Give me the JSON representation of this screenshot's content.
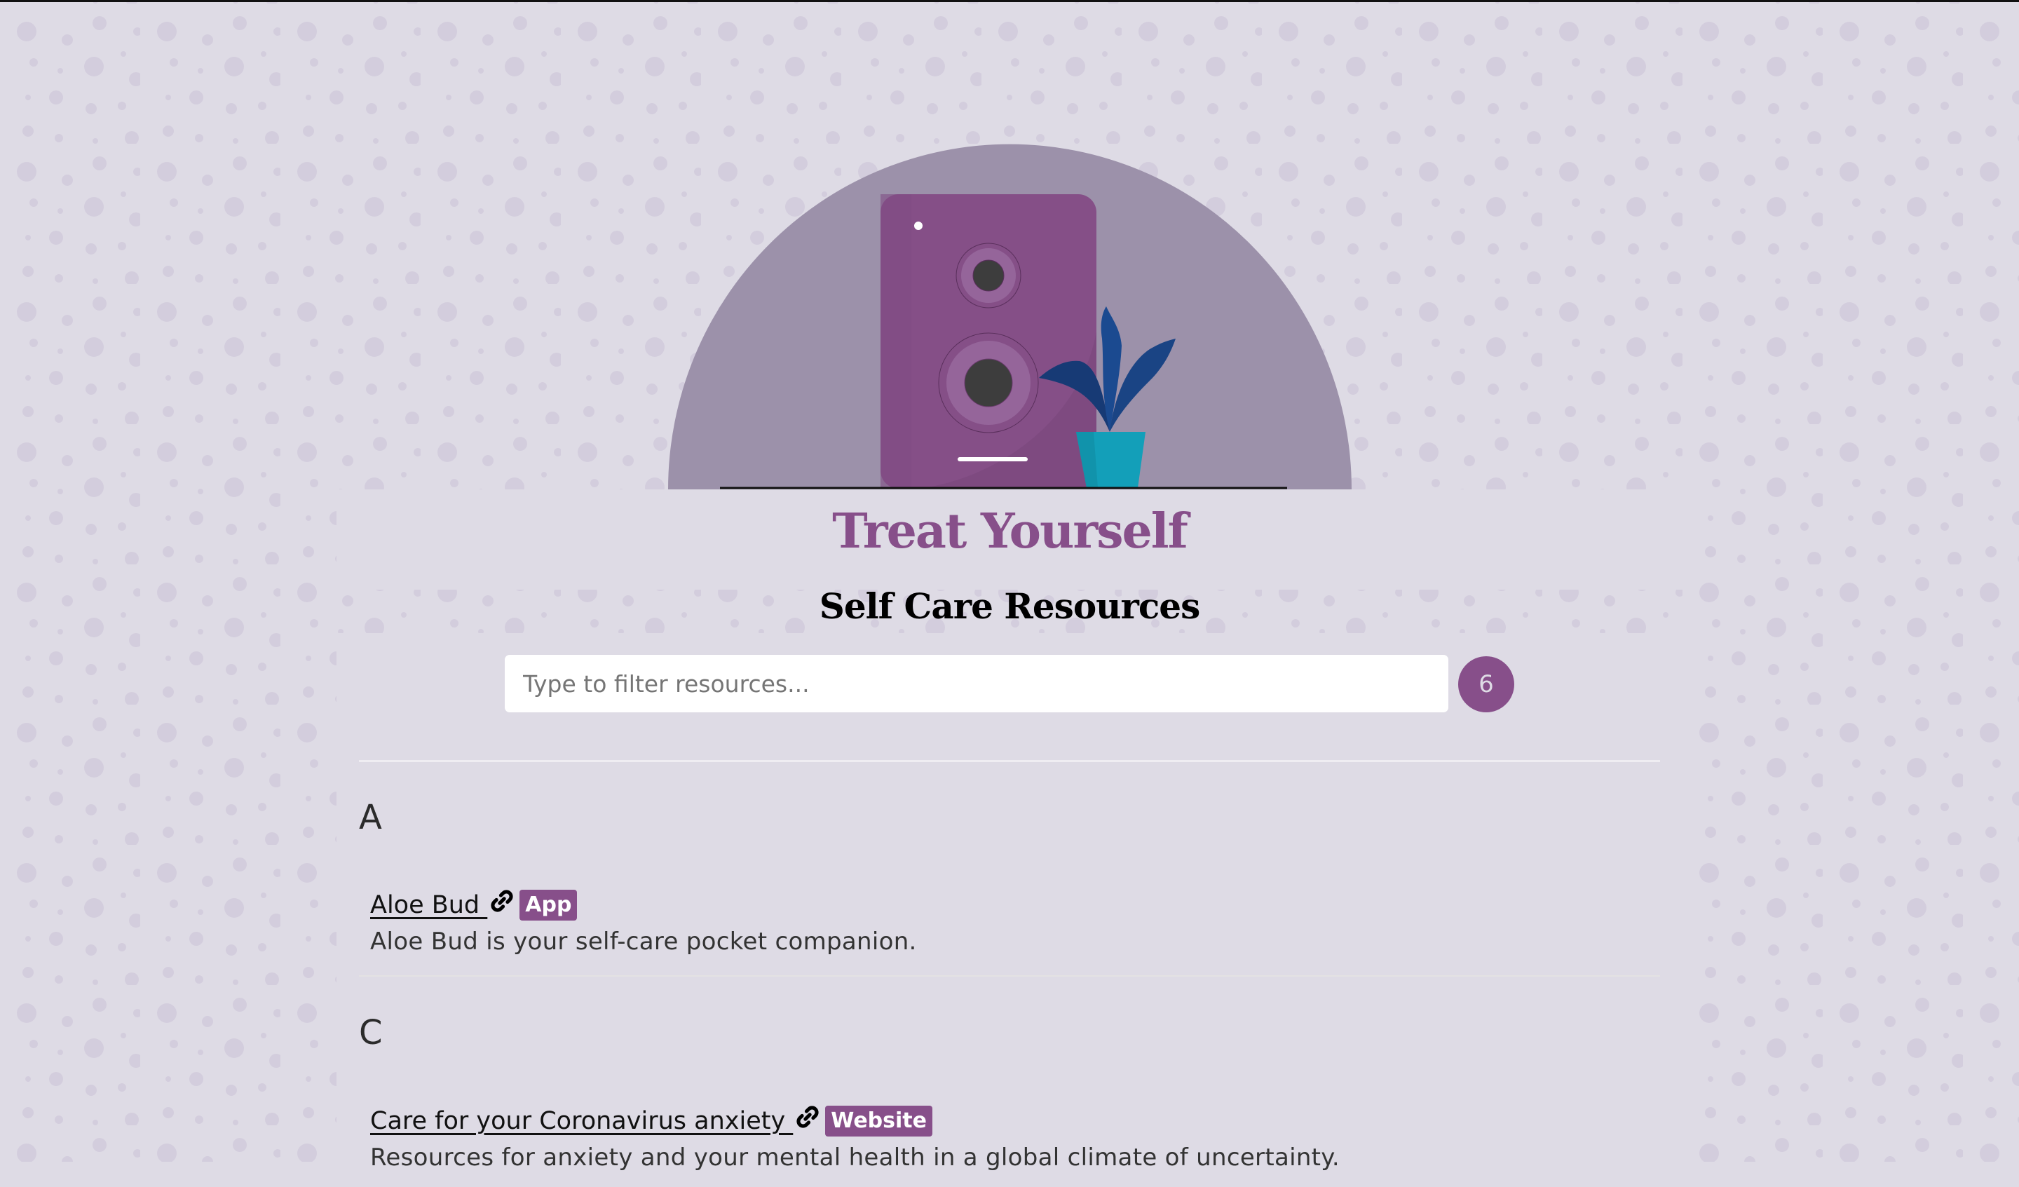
{
  "header": {
    "title": "Treat Yourself",
    "subtitle": "Self Care Resources",
    "hero_illustration": "speaker-with-plant-illustration"
  },
  "filter": {
    "placeholder": "Type to filter resources...",
    "value": "",
    "result_count": "6"
  },
  "sections": [
    {
      "letter": "A",
      "resources": [
        {
          "title": "Aloe Bud ",
          "icon": "link-icon",
          "type": "App",
          "description": "Aloe Bud is your self-care pocket companion."
        }
      ]
    },
    {
      "letter": "C",
      "resources": [
        {
          "title": "Care for your Coronavirus anxiety ",
          "icon": "link-icon",
          "type": "Website",
          "description": "Resources for anxiety and your mental health in a global climate of uncertainty."
        }
      ]
    }
  ],
  "colors": {
    "accent": "#874f8a",
    "background": "#dedbe5",
    "dots": "#d3cddd",
    "arch": "#9c91aa",
    "plant": "#1a4a8f",
    "pot": "#139fb9"
  }
}
